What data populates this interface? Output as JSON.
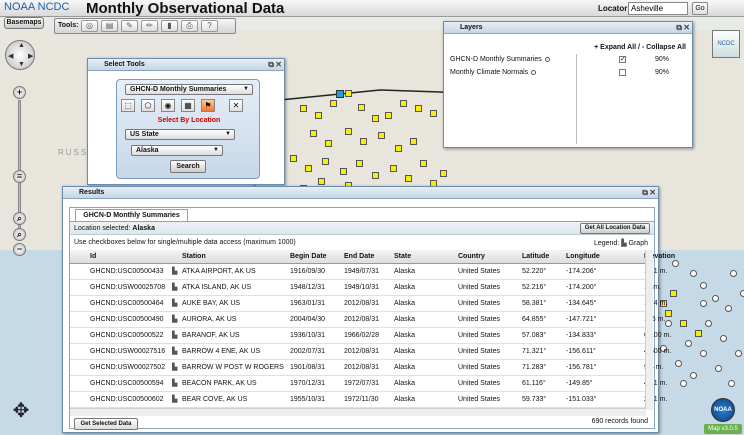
{
  "header": {
    "logo_text": "NOAA NCDC",
    "title": "Monthly Observational Data",
    "locator_label": "Locator:",
    "locator_value": "Asheville",
    "go_label": "Go"
  },
  "toolbar": {
    "basemaps_label": "Basemaps",
    "tools_label": "Tools:"
  },
  "map": {
    "region_label": "RUSS",
    "version": "Map v3.0.5",
    "noaa_label": "NOAA"
  },
  "select_tools": {
    "title": "Select Tools",
    "dataset": "GHCN-D Monthly Summaries",
    "select_by_location": "Select By Location",
    "location_type": "US State",
    "location_value": "Alaska",
    "search_label": "Search"
  },
  "layers": {
    "title": "Layers",
    "actions": "+ Expand All / - Collapse All",
    "items": [
      {
        "label": "GHCN-D Monthly Summaries",
        "opacity": "90%",
        "checked": true
      },
      {
        "label": "Monthly Climate Normals",
        "opacity": "90%",
        "checked": false
      }
    ]
  },
  "results": {
    "title": "Results",
    "tab_label": "GHCN-D Monthly Summaries",
    "location_selected_label": "Location selected:",
    "location_selected_value": "Alaska",
    "get_all_label": "Get All Location Data",
    "note": "Use checkboxes below for single/multiple data access (maximum 1000)",
    "legend_label": "Legend:",
    "legend_graph": "Graph",
    "columns": [
      "Id",
      "Station",
      "Begin Date",
      "End Date",
      "State",
      "Country",
      "Latitude",
      "Longitude",
      "Elevation"
    ],
    "rows": [
      {
        "id": "GHCND:USC00500433",
        "station": "ATKA AIRPORT, AK US",
        "begin": "1916/09/30",
        "end": "1949/07/31",
        "state": "Alaska",
        "country": "United States",
        "lat": "52.220°",
        "lon": "-174.206°",
        "elev": "17.1 m.",
        "checked": false
      },
      {
        "id": "GHCND:USW00025708",
        "station": "ATKA ISLAND, AK US",
        "begin": "1948/12/31",
        "end": "1949/10/31",
        "state": "Alaska",
        "country": "United States",
        "lat": "52.216°",
        "lon": "-174.200°",
        "elev": "11 m.",
        "checked": false
      },
      {
        "id": "GHCND:USC00500464",
        "station": "AUKE BAY, AK US",
        "begin": "1963/01/31",
        "end": "2012/08/31",
        "state": "Alaska",
        "country": "United States",
        "lat": "58.381°",
        "lon": "-134.645°",
        "elev": "13.4 m.",
        "checked": false
      },
      {
        "id": "GHCND:USC00500490",
        "station": "AURORA, AK US",
        "begin": "2004/04/30",
        "end": "2012/08/31",
        "state": "Alaska",
        "country": "United States",
        "lat": "64.855°",
        "lon": "-147.721°",
        "elev": "135 m.",
        "checked": false
      },
      {
        "id": "GHCND:USC00500522",
        "station": "BARANOF, AK US",
        "begin": "1936/10/31",
        "end": "1966/02/28",
        "state": "Alaska",
        "country": "United States",
        "lat": "57.083°",
        "lon": "-134.833°",
        "elev": "6.100 m.",
        "checked": false
      },
      {
        "id": "GHCND:USW00027516",
        "station": "BARROW 4 ENE, AK US",
        "begin": "2002/07/31",
        "end": "2012/08/31",
        "state": "Alaska",
        "country": "United States",
        "lat": "71.321°",
        "lon": "-156.611°",
        "elev": "4.600 m.",
        "checked": false
      },
      {
        "id": "GHCND:USW00027502",
        "station": "BARROW W POST W ROGERS",
        "begin": "1901/08/31",
        "end": "2012/08/31",
        "state": "Alaska",
        "country": "United States",
        "lat": "71.283°",
        "lon": "-156.781°",
        "elev": "9.4 m.",
        "checked": true
      },
      {
        "id": "GHCND:USC00500594",
        "station": "BEACON PARK, AK US",
        "begin": "1970/12/31",
        "end": "1972/07/31",
        "state": "Alaska",
        "country": "United States",
        "lat": "61.116°",
        "lon": "-149.85°",
        "elev": "49.1 m.",
        "checked": false
      },
      {
        "id": "GHCND:USC00500602",
        "station": "BEAR COVE, AK US",
        "begin": "1955/10/31",
        "end": "1972/11/30",
        "state": "Alaska",
        "country": "United States",
        "lat": "59.733°",
        "lon": "-151.033°",
        "elev": "24.1 m.",
        "checked": false
      }
    ],
    "records_found": "690 records found",
    "get_selected_label": "Get Selected Data"
  }
}
